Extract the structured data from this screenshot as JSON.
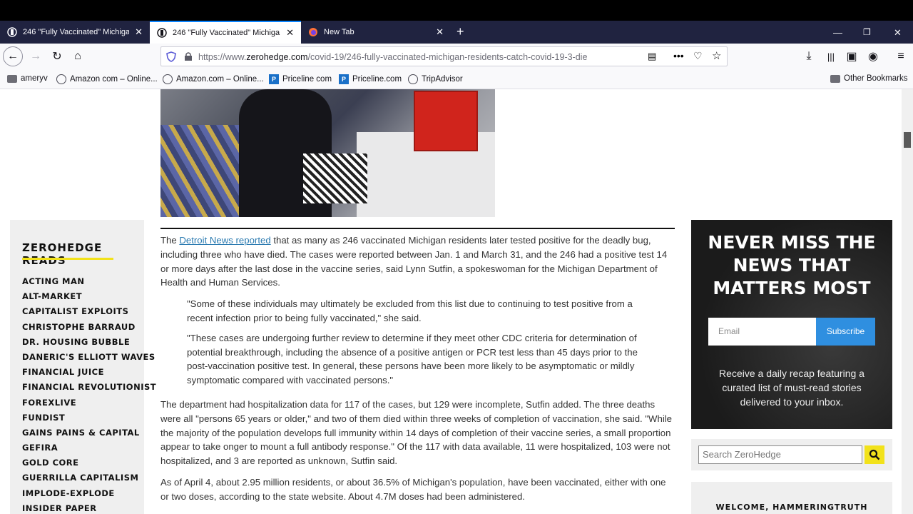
{
  "browser": {
    "tabs": [
      {
        "title": "246 \"Fully Vaccinated\" Michiga"
      },
      {
        "title": "246 \"Fully Vaccinated\" Michiga"
      },
      {
        "title": "New Tab"
      }
    ],
    "url_prefix": "https://www.",
    "url_domain": "zerohedge.com",
    "url_path": "/covid-19/246-fully-vaccinated-michigan-residents-catch-covid-19-3-die",
    "bookmarks": [
      "ameryv",
      "Amazon com – Online...",
      "Amazon.com – Online...",
      "Priceline com",
      "Priceline.com",
      "TripAdvisor"
    ],
    "other_bookmarks": "Other Bookmarks"
  },
  "sidebar": {
    "title": "ZEROHEDGE READS",
    "items": [
      "ACTING MAN",
      "ALT-MARKET",
      "CAPITALIST EXPLOITS",
      "CHRISTOPHE BARRAUD",
      "DR. HOUSING BUBBLE",
      "DANERIC'S ELLIOTT WAVES",
      "FINANCIAL JUICE",
      "FINANCIAL REVOLUTIONIST",
      "FOREXLIVE",
      "FUNDIST",
      "GAINS PAINS & CAPITAL",
      "GEFIRA",
      "GOLD CORE",
      "GUERRILLA CAPITALISM",
      "IMPLODE-EXPLODE",
      "INSIDER PAPER"
    ]
  },
  "article": {
    "p1_lead": "The ",
    "p1_link": "Detroit News reported",
    "p1_rest": " that as many as 246 vaccinated Michigan residents later tested positive for the deadly bug, including three who have died. The cases were reported between Jan. 1 and March 31, and the 246 had a positive test 14 or more days after the last dose in the vaccine series, said Lynn Sutfin, a spokeswoman for the Michigan Department of Health and Human Services.",
    "quote1": "\"Some of these individuals may ultimately be excluded from this list due to continuing to test positive from a recent infection prior to being fully vaccinated,\" she said.",
    "quote2": "\"These cases are undergoing further review to determine if they meet other CDC criteria for determination of potential breakthrough, including the absence of a positive antigen or PCR test less than 45 days prior to the post-vaccination positive test. In general, these persons have been more likely to be asymptomatic or mildly symptomatic compared with vaccinated persons.\"",
    "p2": "The department had hospitalization data for 117 of the cases, but 129 were incomplete, Sutfin added. The three deaths were all \"persons 65 years or older,\" and two of them died within three weeks of completion of vaccination, she said. \"While the majority of the population develops full immunity within 14 days of completion of their vaccine series, a small proportion appear to take onger to mount a full antibody response.\" Of the 117 with data available, 11 were hospitalized, 103 were not hospitalized, and 3 are reported as unknown, Sutfin said.",
    "p3": "As of April 4, about 2.95 million residents, or about 36.5% of Michigan's population, have been vaccinated, either with one or two doses, according to the state website. About 4.7M doses had been administered."
  },
  "promo": {
    "title": "NEVER MISS THE NEWS THAT MATTERS MOST",
    "email_placeholder": "Email",
    "subscribe": "Subscribe",
    "text": "Receive a daily recap featuring a curated list of must-read stories delivered to your inbox."
  },
  "search": {
    "placeholder": "Search ZeroHedge"
  },
  "welcome": "WELCOME, HAMMERINGTRUTH"
}
